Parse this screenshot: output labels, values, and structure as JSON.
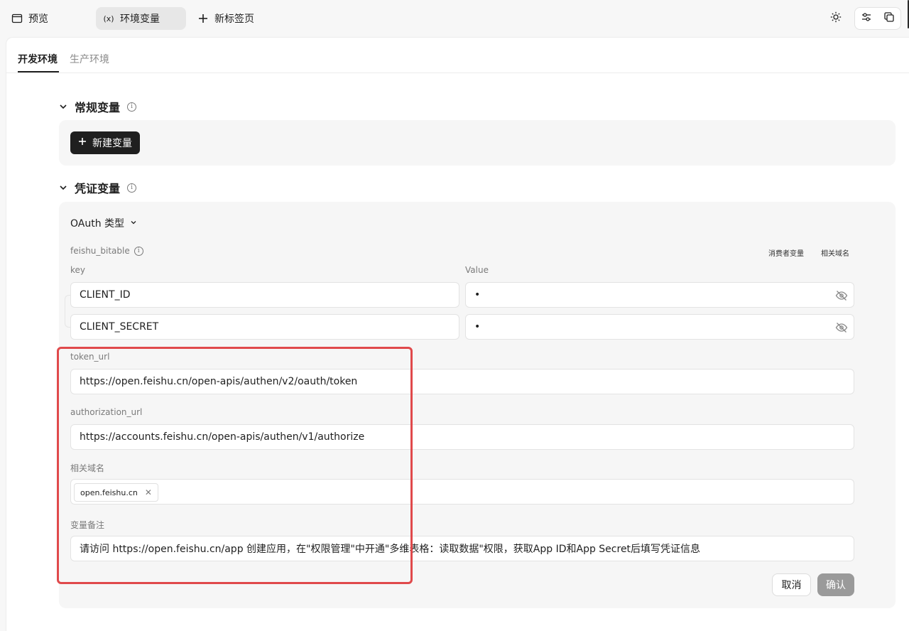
{
  "topbar": {
    "tabs": [
      {
        "label": "预览",
        "icon": "window-icon"
      },
      {
        "label": "环境变量",
        "icon": "variable-icon"
      },
      {
        "label": "新标签页",
        "icon": "plus-icon"
      }
    ],
    "tools": [
      "sun-icon",
      "sliders-icon",
      "copy-icon"
    ]
  },
  "env_tabs": [
    "开发环境",
    "生产环境"
  ],
  "sections": {
    "general": {
      "title": "常规变量",
      "new_button": "新建变量"
    },
    "credential": {
      "title": "凭证变量"
    }
  },
  "credential": {
    "auth_type": "OAuth 类型",
    "name": "feishu_bitable",
    "actions": [
      "消费者变量",
      "相关域名"
    ],
    "key_header": "key",
    "value_header": "Value",
    "rows": [
      {
        "key": "CLIENT_ID",
        "value": "•"
      },
      {
        "key": "CLIENT_SECRET",
        "value": "•"
      }
    ],
    "token_url_label": "token_url",
    "token_url": "https://open.feishu.cn/open-apis/authen/v2/oauth/token",
    "authorization_url_label": "authorization_url",
    "authorization_url": "https://accounts.feishu.cn/open-apis/authen/v1/authorize",
    "domains_label": "相关域名",
    "domains": [
      "open.feishu.cn"
    ],
    "note_label": "变量备注",
    "note": "请访问 https://open.feishu.cn/app 创建应用，在\"权限管理\"中开通\"多维表格：读取数据\"权限，获取App ID和App Secret后填写凭证信息"
  },
  "footer": {
    "cancel": "取消",
    "confirm": "确认"
  },
  "colors": {
    "highlight": "#e0494b",
    "primary": "#1f1f1f",
    "disabled": "#9a9a9a"
  }
}
